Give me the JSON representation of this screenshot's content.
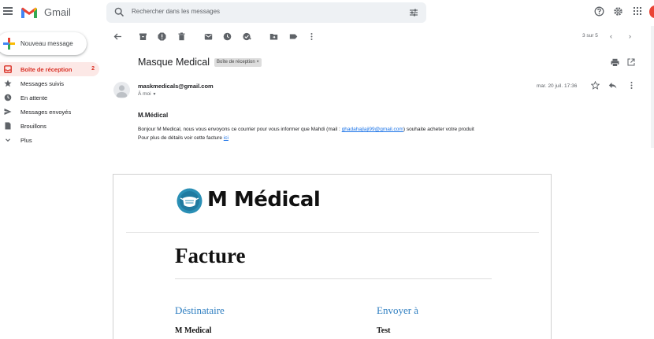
{
  "app": {
    "name": "Gmail"
  },
  "search": {
    "placeholder": "Rechercher dans les messages"
  },
  "sidebar": {
    "compose_label": "Nouveau message",
    "items": [
      {
        "label": "Boîte de réception",
        "count": "2",
        "icon": "inbox-icon",
        "active": true
      },
      {
        "label": "Messages suivis",
        "icon": "star-icon"
      },
      {
        "label": "En attente",
        "icon": "clock-icon"
      },
      {
        "label": "Messages envoyés",
        "icon": "send-icon"
      },
      {
        "label": "Brouillons",
        "icon": "draft-icon"
      },
      {
        "label": "Plus",
        "icon": "chevron-down-icon"
      }
    ]
  },
  "toolbar": {
    "icons": [
      "back-arrow-icon",
      "archive-icon",
      "report-spam-icon",
      "delete-icon",
      "mark-unread-icon",
      "snooze-icon",
      "add-task-icon",
      "move-to-icon",
      "label-icon",
      "more-vert-icon"
    ],
    "pager": "3 sur 5"
  },
  "message": {
    "subject": "Masque Medical",
    "label_chip": "Boîte de réception ×",
    "sender": "maskmedicals@gmail.com",
    "to": "À moi",
    "date": "mar. 20 juil. 17:36",
    "title": "M.Médical",
    "line1_before": "Bonjour M Medical, nous vous envoyons ce courrier pour vous informer que Mahdi (mail : ",
    "line1_link": "ghadahajlaji99@gmail.com",
    "line1_after": ") souhaite acheter votre produit",
    "line2_before": "Pour plus de détails voir cette facture ",
    "line2_link": "ici"
  },
  "invoice": {
    "brand": "M Médical",
    "title": "Facture",
    "recipient_heading": "Déstinataire",
    "recipient_value": "M Medical",
    "send_to_heading": "Envoyer à",
    "send_to_value": "Test"
  },
  "colors": {
    "accent_red": "#d93025",
    "link_blue": "#1a73e8",
    "invoice_heading_blue": "#2f7fc1",
    "brand_teal": "#2a8fb5"
  }
}
